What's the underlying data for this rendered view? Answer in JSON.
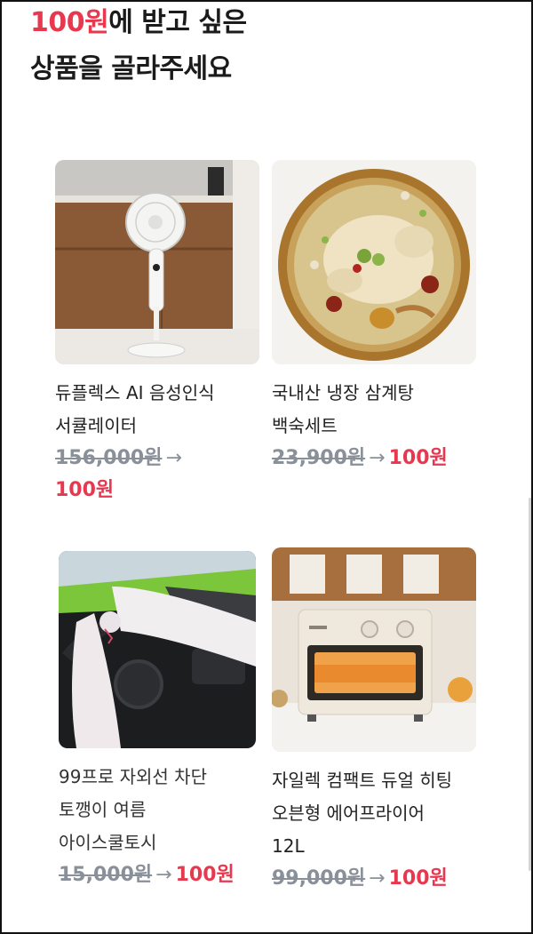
{
  "headline": {
    "accent": "100원",
    "line1_rest": "에 받고 싶은",
    "line2": "상품을 골라주세요"
  },
  "products": [
    {
      "name_lines": [
        "듀플렉스 AI 음성인식",
        "서큘레이터"
      ],
      "original_price": "156,000원",
      "arrow": "→",
      "sale_price": "100원",
      "icon": "circulator-fan-image"
    },
    {
      "name_lines": [
        "국내산 냉장 삼계탕",
        "백숙세트"
      ],
      "original_price": "23,900원",
      "arrow": "→",
      "sale_price": "100원",
      "icon": "samgyetang-image"
    },
    {
      "name_lines": [
        "99프로 자외선 차단",
        "토깽이 여름",
        "아이스쿨토시"
      ],
      "original_price": "15,000원",
      "arrow": "→",
      "sale_price": "100원",
      "icon": "arm-sleeve-image"
    },
    {
      "name_lines": [
        "자일렉 컴팩트 듀얼 히팅",
        "오븐형 에어프라이어",
        "12L"
      ],
      "original_price": "99,000원",
      "arrow": "→",
      "sale_price": "100원",
      "icon": "air-fryer-image"
    }
  ],
  "colors": {
    "accent": "#e8384f",
    "strike_gray": "#8a9099",
    "text": "#222222"
  }
}
